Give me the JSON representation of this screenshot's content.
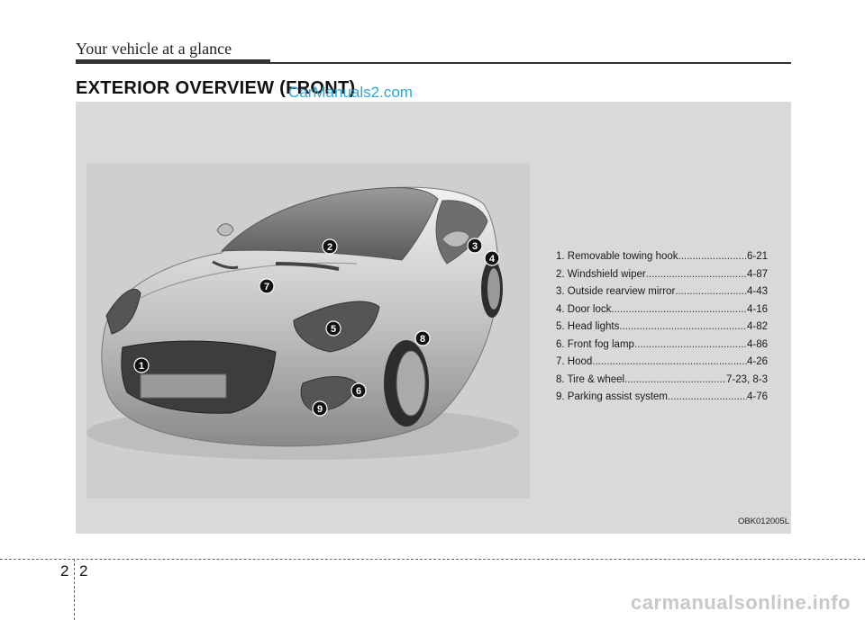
{
  "header": {
    "title": "Your vehicle at a glance"
  },
  "section_title": "EXTERIOR OVERVIEW (FRONT)",
  "watermark_top": "CarManuals2.com",
  "legend": [
    {
      "label": "1. Removable towing hook",
      "page": "6-21"
    },
    {
      "label": "2. Windshield wiper",
      "page": "4-87"
    },
    {
      "label": "3. Outside rearview mirror",
      "page": "4-43"
    },
    {
      "label": "4. Door lock",
      "page": "4-16"
    },
    {
      "label": "5. Head lights",
      "page": "4-82"
    },
    {
      "label": "6. Front fog lamp",
      "page": "4-86"
    },
    {
      "label": "7. Hood",
      "page": "4-26"
    },
    {
      "label": "8. Tire & wheel",
      "page": "7-23, 8-3"
    },
    {
      "label": "9. Parking assist system",
      "page": "4-76"
    }
  ],
  "callouts": [
    "1",
    "2",
    "3",
    "4",
    "5",
    "6",
    "7",
    "8",
    "9"
  ],
  "figure_code": "OBK012005L",
  "footer": {
    "chapter": "2",
    "page": "2"
  },
  "watermark_bottom": "carmanualsonline.info"
}
